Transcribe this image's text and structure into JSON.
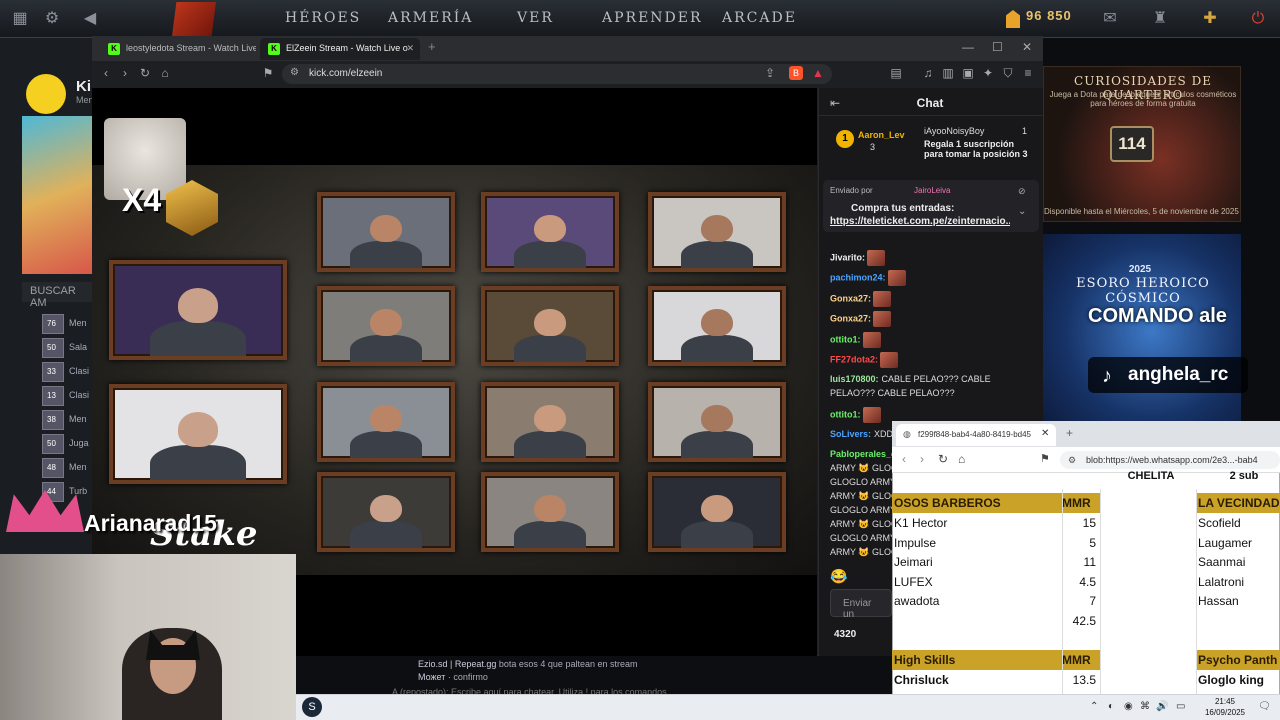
{
  "dota": {
    "nav": [
      "HÉROES",
      "ARMERÍA",
      "VER",
      "APRENDER",
      "ARCADE"
    ],
    "gold": "96 850",
    "profile_name": "Ki",
    "profile_sub": "Men",
    "search_label": "BUSCAR AM",
    "friends": [
      {
        "lvl": "76",
        "text": "Men"
      },
      {
        "lvl": "50",
        "text": "Sala"
      },
      {
        "lvl": "33",
        "text": "Clasi"
      },
      {
        "lvl": "13",
        "text": "Clasi"
      },
      {
        "lvl": "38",
        "text": "Men"
      },
      {
        "lvl": "50",
        "text": "Juga"
      },
      {
        "lvl": "48",
        "text": "Men"
      },
      {
        "lvl": "44",
        "text": "Turb"
      }
    ],
    "quartero": {
      "title": "CURIOSIDADES DE QUARTERO",
      "sub": "Juega a Dota para desbloquear artículos cosméticos para héroes de forma gratuita",
      "count": "114",
      "foot": "Disponible hasta el Miércoles, 5 de noviembre de 2025"
    },
    "tesoro": {
      "year": "2025",
      "title": "ESORO HEROICO CÓSMICO"
    }
  },
  "overlay": {
    "comando": "COMANDO ale",
    "tiktok": "anghela_rc",
    "streamer": "Arianarad15",
    "stake": "Stake"
  },
  "browser": {
    "tabs": [
      {
        "label": "leostyledota Stream - Watch Live",
        "active": false
      },
      {
        "label": "ElZeein Stream - Watch Live o",
        "active": true
      }
    ],
    "url": "kick.com/elzeein"
  },
  "chat": {
    "title": "Chat",
    "gift": {
      "top_user": "Aaron_Lev",
      "top_user_count": "3",
      "second_user": "iAyooNoisyBoy",
      "second_count": "1",
      "gift_text": "Regala 1 suscripción para tomar la posición 3"
    },
    "pinned": {
      "sent_by_label": "Enviado por",
      "sent_by_user": "JairoLeiva",
      "title": "Compra tus entradas:",
      "link": "https://teleticket.com.pe/zeinternacio..."
    },
    "messages": [
      {
        "user": "Jivarito:",
        "color": "#f0f0f0",
        "text": "",
        "emote": true
      },
      {
        "user": "pachimon24:",
        "color": "#4aa3ff",
        "text": "",
        "emote": true
      },
      {
        "user": "Gonxa27:",
        "color": "#ffd28a",
        "text": "",
        "emote": true
      },
      {
        "user": "Gonxa27:",
        "color": "#ffd28a",
        "text": "",
        "emote": true
      },
      {
        "user": "ottito1:",
        "color": "#6af06a",
        "text": "",
        "emote": true
      },
      {
        "user": "FF27dota2:",
        "color": "#ff4a4a",
        "text": "",
        "emote": true
      },
      {
        "user": "luis170800:",
        "color": "#9be89b",
        "text": "CABLE PELAO??? CABLE",
        "emote": false
      },
      {
        "user": "",
        "color": "#ddd",
        "text": "PELAO??? CABLE PELAO???",
        "emote": false
      },
      {
        "user": "ottito1:",
        "color": "#6af06a",
        "text": "",
        "emote": true
      },
      {
        "user": "SoLivers:",
        "color": "#4aa3ff",
        "text": "XDD",
        "emote": false
      },
      {
        "user": "Pabloperales_c",
        "color": "#6af06a",
        "text": "",
        "emote": false
      },
      {
        "user": "",
        "color": "#ddd",
        "text": "ARMY 😺 GLOG",
        "emote": false
      },
      {
        "user": "",
        "color": "#ddd",
        "text": "GLOGLO ARMY",
        "emote": false
      },
      {
        "user": "",
        "color": "#ddd",
        "text": "ARMY 😺 GLOG",
        "emote": false
      },
      {
        "user": "",
        "color": "#ddd",
        "text": "GLOGLO ARMY",
        "emote": false
      },
      {
        "user": "",
        "color": "#ddd",
        "text": "ARMY 😺 GLOG",
        "emote": false
      },
      {
        "user": "",
        "color": "#ddd",
        "text": "GLOGLO ARMY",
        "emote": false
      },
      {
        "user": "",
        "color": "#ddd",
        "text": "ARMY 😺 GLOG",
        "emote": false
      }
    ],
    "input_placeholder": "Enviar un",
    "viewers": "4320"
  },
  "bottom_overlay": {
    "line1_user": "Ezio.sd | Repeat.gg",
    "line1_text": " bota esos 4 que paltean en stream",
    "line2_user": "Может",
    "line2_text": " · confirmo",
    "line3": "A (repostado): Escribe aquí para chatear. Utiliza ! para los comandos"
  },
  "sheet": {
    "tab_title": "f299f848-bab4-4a80-8419-bd45",
    "url": "blob:https://web.whatsapp.com/2e3...-bab4",
    "top_cells": [
      "CHELITA",
      "2 sub"
    ],
    "team1": {
      "header": "OSOS BARBEROS",
      "mmr_header": "MMR",
      "rows": [
        {
          "name": "K1 Hector",
          "mmr": "15"
        },
        {
          "name": "Impulse",
          "mmr": "5"
        },
        {
          "name": "Jeimari",
          "mmr": "11"
        },
        {
          "name": "LUFEX",
          "mmr": "4.5"
        },
        {
          "name": "awadota",
          "mmr": "7"
        }
      ],
      "total": "42.5"
    },
    "team2": {
      "header": "LA VECINDAD",
      "rows": [
        "Scofield",
        "Laugamer",
        "Saanmai",
        "Lalatroni",
        "Hassan"
      ]
    },
    "team3": {
      "header": "High Skills",
      "mmr_header": "MMR",
      "rows": [
        {
          "name": "Chrisluck",
          "mmr": "13.5"
        }
      ]
    },
    "team4": {
      "header": "Psycho Panth",
      "rows": [
        "Gloglo king"
      ]
    }
  },
  "taskbar": {
    "time": "21:45",
    "date": "16/09/2025"
  },
  "colors": {
    "kick_green": "#53fc18",
    "chat_bg": "#18181b",
    "sheet_header": "#c9a227"
  }
}
